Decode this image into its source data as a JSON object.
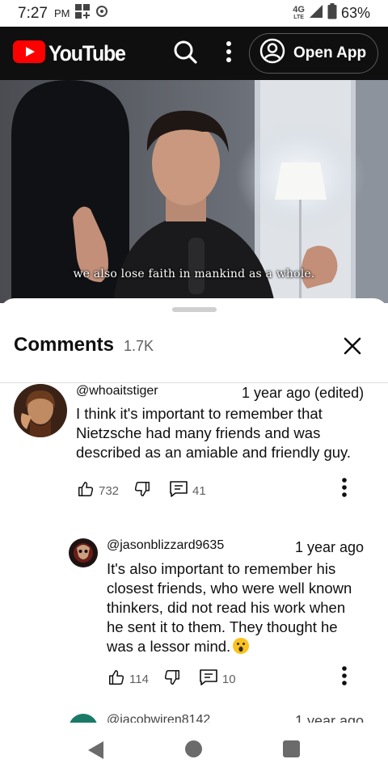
{
  "status_bar": {
    "time": "7:27",
    "ampm": "PM",
    "network": "4G",
    "network_sub": "LTE",
    "battery": "63%"
  },
  "header": {
    "logo_text": "YouTube",
    "open_app_label": "Open App"
  },
  "video": {
    "caption": "we also lose faith in mankind as a whole."
  },
  "comments": {
    "title": "Comments",
    "count": "1.7K",
    "items": [
      {
        "author": "@whoaitstiger",
        "time": "1 year ago (edited)",
        "lines": [
          "I think it's important to remember that",
          "Nietzsche had many friends and was",
          "described as an amiable and friendly guy."
        ],
        "likes": "732",
        "replies": "41"
      },
      {
        "author": "@jasonblizzard9635",
        "time": "1 year ago",
        "lines": [
          "It's also important to remember his",
          "closest friends, who were well known",
          "thinkers, did not read his work when",
          "he sent it to them. They thought he",
          "was a lessor mind."
        ],
        "likes": "114",
        "replies": "10"
      },
      {
        "author": "@jacobwiren8142",
        "time": "1 year ago"
      }
    ]
  },
  "colors": {
    "header_bg": "#0f0f0f",
    "yt_red": "#ff0000",
    "secondary_text": "#606060"
  },
  "icons": {
    "status": [
      "grid-apps-icon",
      "vpn-icon",
      "signal-icon",
      "battery-icon"
    ],
    "header": [
      "youtube-play-icon",
      "search-icon",
      "more-vert-icon",
      "account-circle-icon"
    ],
    "comment_actions": [
      "thumb-up-icon",
      "thumb-down-icon",
      "reply-icon",
      "more-vert-icon"
    ],
    "nav": [
      "back-triangle-icon",
      "home-circle-icon",
      "recents-square-icon"
    ]
  }
}
